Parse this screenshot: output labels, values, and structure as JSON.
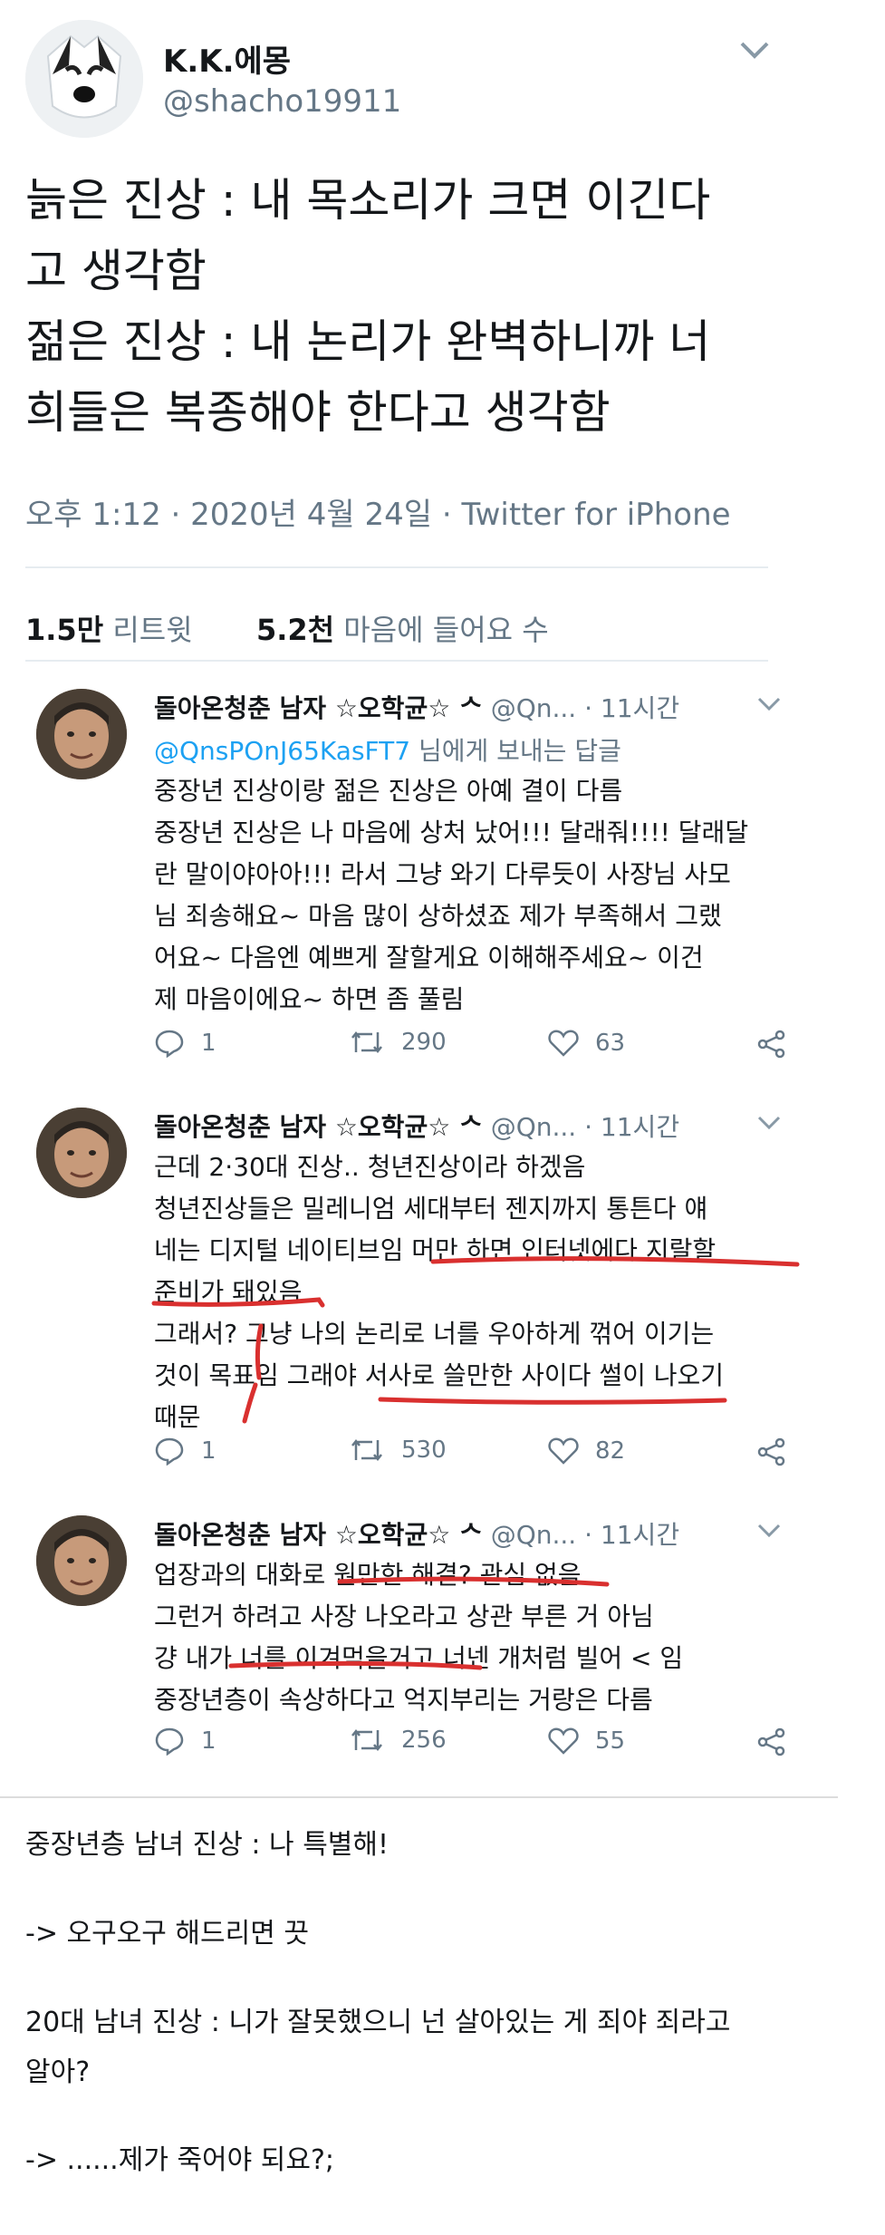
{
  "author": {
    "name": "K.K.에몽",
    "handle": "@shacho19911"
  },
  "tweet": {
    "lines": [
      "늙은 진상 : 내 목소리가 크면 이긴다",
      "고 생각함",
      "젊은 진상 : 내 논리가 완벽하니까 너",
      "희들은 복종해야 한다고 생각함"
    ],
    "time": "오후 1:12",
    "date": "2020년 4월 24일",
    "source": "Twitter for iPhone"
  },
  "stats": {
    "retweets_count": "1.5만",
    "retweets_label": "리트윗",
    "likes_count": "5.2천",
    "likes_label": "마음에 들어요 수"
  },
  "replies": [
    {
      "name": "돌아온청춘 남자 ☆오학균☆ ᄉ",
      "handle": "@Qn...",
      "time": "· 11시간",
      "reply_to": "@QnsPOnJ65KasFT7",
      "reply_to_suffix": "님에게 보내는 답글",
      "lines": [
        "중장년 진상이랑 젊은 진상은 아예 결이 다름",
        "중장년 진상은 나 마음에 상처 났어!!! 달래줘!!!! 달래달",
        "란 말이야아아!!! 라서 그냥 와기 다루듯이 사장님 사모",
        "님 죄송해요~ 마음 많이 상하셨죠 제가 부족해서 그랬",
        "어요~ 다음엔 예쁘게 잘할게요 이해해주세요~ 이건",
        "제 마음이에요~ 하면 좀 풀림"
      ],
      "comments": "1",
      "retweets": "290",
      "likes": "63"
    },
    {
      "name": "돌아온청춘 남자 ☆오학균☆ ᄉ",
      "handle": "@Qn...",
      "time": "· 11시간",
      "lines": [
        "근데 2·30대 진상.. 청년진상이라 하겠음",
        "청년진상들은 밀레니엄 세대부터 젠지까지 통튼다 얘",
        "네는 디지털 네이티브임 머만 하면 인터넷에다 지랄할",
        "준비가 돼있음",
        "그래서? 그냥 나의 논리로 너를 우아하게 꺾어 이기는",
        "것이 목표임 그래야 서사로 쓸만한 사이다 썰이 나오기",
        "때문"
      ],
      "comments": "1",
      "retweets": "530",
      "likes": "82"
    },
    {
      "name": "돌아온청춘 남자 ☆오학균☆ ᄉ",
      "handle": "@Qn...",
      "time": "· 11시간",
      "lines": [
        "업장과의 대화로 원만한 해결? 관심 없음",
        "그런거 하려고 사장 나오라고 상관 부른 거 아님",
        "걍 내가 너를 이겨먹을거고 너넨 개처럼 빌어 < 임",
        "중장년층이 속상하다고 억지부리는 거랑은 다름"
      ],
      "comments": "1",
      "retweets": "256",
      "likes": "55"
    }
  ],
  "bottom": {
    "line1": "중장년층 남녀 진상 : 나 특별해!",
    "line2": "-> 오구오구 해드리면 끗",
    "line3": "20대 남녀 진상 : 니가 잘못했으니 넌 살아있는 게 죄야 죄라고",
    "line4": "알아?",
    "line5": "-> ......제가 죽어야 되요?;"
  },
  "colors": {
    "link": "#1da1f2",
    "muted": "#657786",
    "ink": "#d9302f"
  }
}
